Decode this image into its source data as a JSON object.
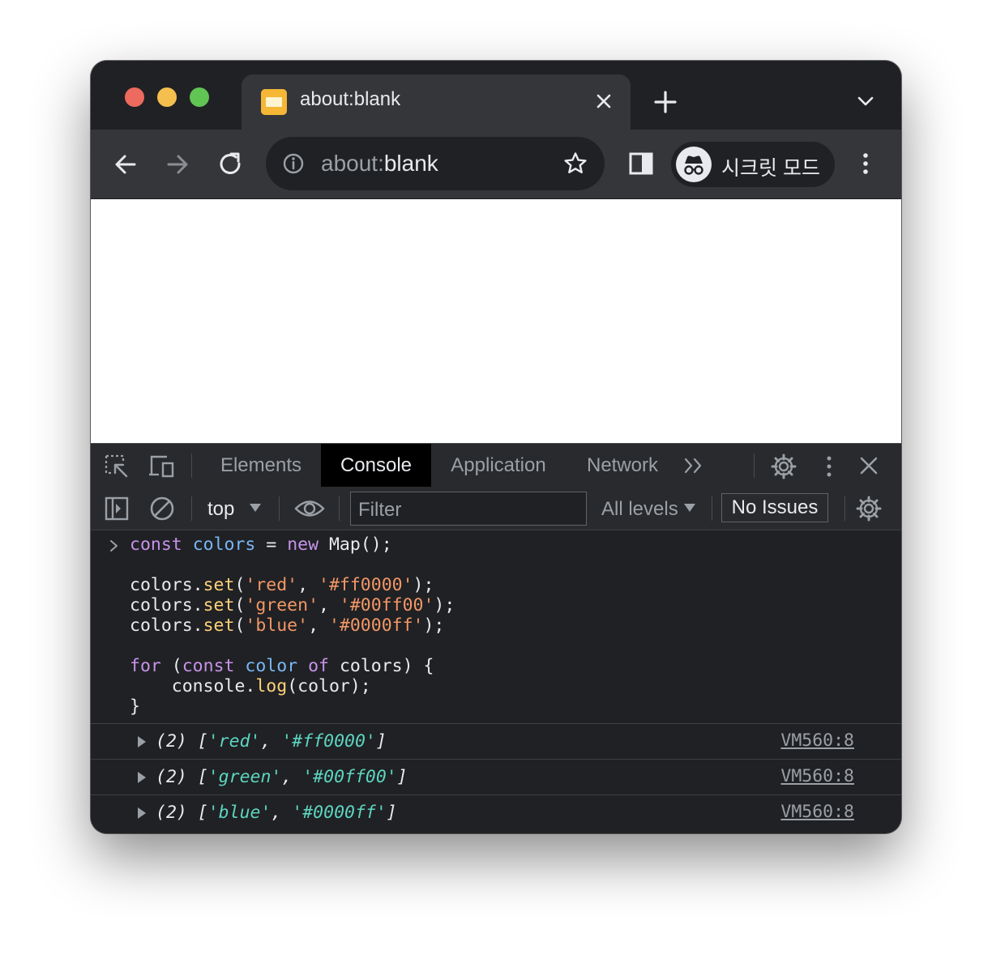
{
  "window": {
    "traffic_lights": [
      {
        "name": "close",
        "color": "#ed6a5e"
      },
      {
        "name": "minimize",
        "color": "#f5bf4f"
      },
      {
        "name": "zoom",
        "color": "#61c554"
      }
    ]
  },
  "tab": {
    "title": "about:blank"
  },
  "toolbar": {
    "url_scheme": "about:",
    "url_host": "blank",
    "incognito_label": "시크릿 모드"
  },
  "devtools": {
    "tabs": [
      "Elements",
      "Console",
      "Application",
      "Network"
    ],
    "active_tab": "Console",
    "console_bar": {
      "context": "top",
      "filter_placeholder": "Filter",
      "levels": "All levels",
      "issues": "No Issues"
    }
  },
  "console": {
    "input_lines": [
      "const colors = new Map();",
      "",
      "colors.set('red', '#ff0000');",
      "colors.set('green', '#00ff00');",
      "colors.set('blue', '#0000ff');",
      "",
      "for (const color of colors) {",
      "    console.log(color);",
      "}"
    ],
    "outputs": [
      {
        "prefix": "(2) [",
        "items": [
          "'red'",
          "'#ff0000'"
        ],
        "source": "VM560:8"
      },
      {
        "prefix": "(2) [",
        "items": [
          "'green'",
          "'#00ff00'"
        ],
        "source": "VM560:8"
      },
      {
        "prefix": "(2) [",
        "items": [
          "'blue'",
          "'#0000ff'"
        ],
        "source": "VM560:8"
      }
    ]
  },
  "colors": {
    "tab_bg": "#35363a",
    "frame_bg": "#202124",
    "devtools_active_tab": "#000000",
    "string_color": "#5cd5c1"
  }
}
